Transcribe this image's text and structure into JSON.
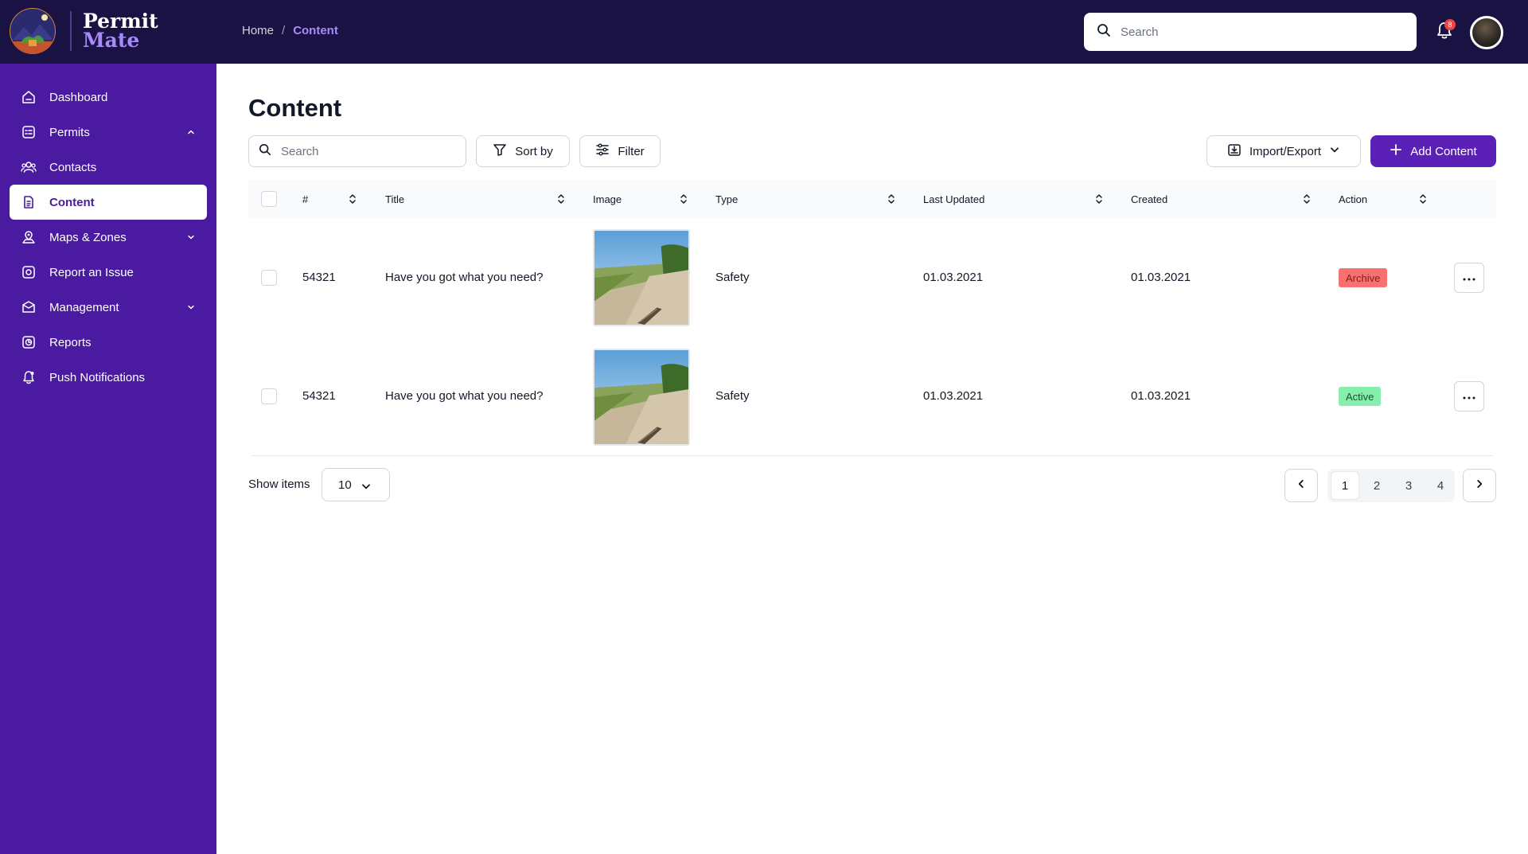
{
  "brand": {
    "line1": "Permit",
    "line2": "Mate"
  },
  "breadcrumb": {
    "home": "Home",
    "separator": "/",
    "current": "Content"
  },
  "topbar": {
    "search_placeholder": "Search",
    "notification_count": "8"
  },
  "sidebar": {
    "items": [
      {
        "label": "Dashboard",
        "icon": "dashboard-icon"
      },
      {
        "label": "Permits",
        "icon": "permits-icon",
        "expanded": true
      },
      {
        "label": "Contacts",
        "icon": "contacts-icon"
      },
      {
        "label": "Content",
        "icon": "content-icon",
        "active": true
      },
      {
        "label": "Maps & Zones",
        "icon": "map-icon",
        "expanded": false
      },
      {
        "label": "Report an Issue",
        "icon": "report-issue-icon"
      },
      {
        "label": "Management",
        "icon": "management-icon",
        "expanded": false
      },
      {
        "label": "Reports",
        "icon": "reports-icon"
      },
      {
        "label": "Push Notifications",
        "icon": "push-notification-icon"
      }
    ]
  },
  "page": {
    "title": "Content"
  },
  "toolbar": {
    "search_placeholder": "Search",
    "sort_label": "Sort by",
    "filter_label": "Filter",
    "import_export_label": "Import/Export",
    "add_label": "Add Content"
  },
  "table": {
    "columns": [
      "#",
      "Title",
      "Image",
      "Type",
      "Last Updated",
      "Created",
      "Action"
    ],
    "rows": [
      {
        "id": "54321",
        "title": "Have you got what you need?",
        "type": "Safety",
        "last_updated": "01.03.2021",
        "created": "01.03.2021",
        "status": "Archive"
      },
      {
        "id": "54321",
        "title": "Have you got what you need?",
        "type": "Safety",
        "last_updated": "01.03.2021",
        "created": "01.03.2021",
        "status": "Active"
      }
    ]
  },
  "footer": {
    "show_items_label": "Show items",
    "page_size": "10",
    "pages": [
      "1",
      "2",
      "3",
      "4"
    ],
    "current_page": "1"
  },
  "colors": {
    "topbar": "#1b1244",
    "sidebar": "#4a1ba0",
    "accent": "#5b21b6",
    "archive_bg": "#f87171",
    "active_bg": "#86efac"
  }
}
